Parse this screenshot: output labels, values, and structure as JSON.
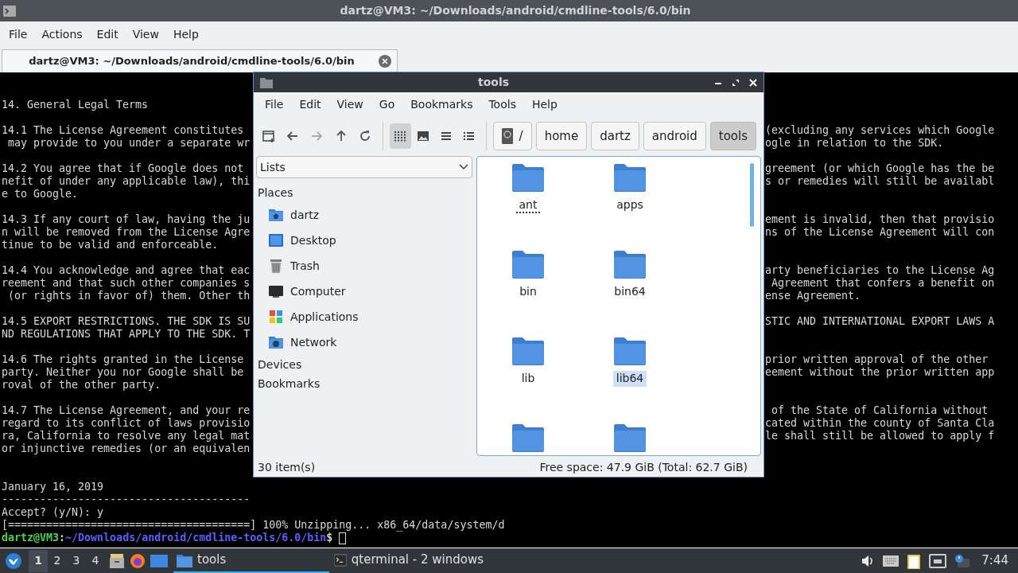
{
  "terminal": {
    "title": "dartz@VM3: ~/Downloads/android/cmdline-tools/6.0/bin",
    "menu": [
      "File",
      "Actions",
      "Edit",
      "View",
      "Help"
    ],
    "tab": {
      "label": "dartz@VM3: ~/Downloads/android/cmdline-tools/6.0/bin"
    },
    "paragraphs": [
      [
        {
          "left": "14. General Legal Terms"
        }
      ],
      [
        {
          "left": "14.1 The License Agreement constitutes",
          "right": "(excluding any services which Google"
        },
        {
          "left": " may provide to you under a separate wr",
          "right": "ogle in relation to the SDK."
        }
      ],
      [
        {
          "left": "14.2 You agree that if Google does not",
          "right": "greement (or which Google has the be"
        },
        {
          "left": "nefit of under any applicable law), thi",
          "right": "s or remedies will still be availabl"
        },
        {
          "left": "e to Google."
        }
      ],
      [
        {
          "left": "14.3 If any court of law, having the ju",
          "right": "ement is invalid, then that provisio"
        },
        {
          "left": "n will be removed from the License Agre",
          "right": "ns of the License Agreement will con"
        },
        {
          "left": "tinue to be valid and enforceable."
        }
      ],
      [
        {
          "left": "14.4 You acknowledge and agree that eac",
          "right": "arty beneficiaries to the License Ag"
        },
        {
          "left": "reement and that such other companies s",
          "right": " Agreement that confers a benefit on"
        },
        {
          "left": " (or rights in favor of) them. Other th",
          "right": "ense Agreement."
        }
      ],
      [
        {
          "left": "14.5 EXPORT RESTRICTIONS. THE SDK IS SU",
          "right": "STIC AND INTERNATIONAL EXPORT LAWS A"
        },
        {
          "left": "ND REGULATIONS THAT APPLY TO THE SDK. T"
        }
      ],
      [
        {
          "left": "14.6 The rights granted in the License",
          "right": "prior written approval of the other"
        },
        {
          "left": "party. Neither you nor Google shall be",
          "right": "eement without the prior written app"
        },
        {
          "left": "roval of the other party."
        }
      ],
      [
        {
          "left": "14.7 The License Agreement, and your re",
          "right": " of the State of California without"
        },
        {
          "left": "regard to its conflict of laws provisio",
          "right": "cated within the county of Santa Cla"
        },
        {
          "left": "ra, California to resolve any legal mat",
          "right": "le shall still be allowed to apply f"
        },
        {
          "left": "or injunctive remedies (or an equivalen"
        }
      ]
    ],
    "output": [
      "January 16, 2019",
      "---------------------------------------",
      "Accept? (y/N): y",
      "[======================================] 100% Unzipping... x86_64/data/system/d"
    ],
    "prompt": {
      "user": "dartz@VM3",
      "separator": ":",
      "path": "~/Downloads/android/cmdline-tools/6.0/bin",
      "symbol": "$"
    }
  },
  "file_manager": {
    "title": "tools",
    "menu": [
      "File",
      "Edit",
      "View",
      "Go",
      "Bookmarks",
      "Tools",
      "Help"
    ],
    "view_modes": [
      {
        "selected": true
      },
      {
        "selected": false
      },
      {
        "selected": false
      },
      {
        "selected": false
      }
    ],
    "path": [
      {
        "label": "/",
        "selected": false
      },
      {
        "label": "home",
        "selected": false
      },
      {
        "label": "dartz",
        "selected": false
      },
      {
        "label": "android",
        "selected": false
      },
      {
        "label": "tools",
        "selected": true
      }
    ],
    "side_pane": {
      "dropdown": "Lists",
      "sections": [
        {
          "heading": "Places",
          "items": [
            {
              "label": "dartz",
              "kind": "home"
            },
            {
              "label": "Desktop",
              "kind": "desktop"
            },
            {
              "label": "Trash",
              "kind": "trash"
            },
            {
              "label": "Computer",
              "kind": "computer"
            },
            {
              "label": "Applications",
              "kind": "applications"
            },
            {
              "label": "Network",
              "kind": "network"
            }
          ]
        },
        {
          "heading": "Devices"
        },
        {
          "heading": "Bookmarks"
        }
      ]
    },
    "files": [
      {
        "kind": "folder",
        "name": "ant",
        "selected": false,
        "focused": true
      },
      {
        "kind": "folder",
        "name": "apps",
        "selected": false,
        "focused": false
      },
      {
        "kind": "folder",
        "name": "bin",
        "selected": false,
        "focused": false
      },
      {
        "kind": "folder",
        "name": "bin64",
        "selected": false,
        "focused": false
      },
      {
        "kind": "folder",
        "name": "lib",
        "selected": false,
        "focused": false
      },
      {
        "kind": "folder",
        "name": "lib64",
        "selected": true,
        "focused": false
      },
      {
        "kind": "folder"
      },
      {
        "kind": "folder"
      }
    ],
    "status": {
      "count": "30 item(s)",
      "free_space": "Free space: 47.9 GiB (Total: 62.7 GiB)"
    }
  },
  "taskbar": {
    "workspaces": [
      {
        "label": "1",
        "selected": true
      },
      {
        "label": "2",
        "selected": false
      },
      {
        "label": "3",
        "selected": false
      },
      {
        "label": "4",
        "selected": false
      }
    ],
    "tasks": [
      {
        "label": "tools",
        "selected": true
      },
      {
        "label": "qterminal - 2 windows",
        "selected": false
      }
    ],
    "clock": "7:44"
  }
}
